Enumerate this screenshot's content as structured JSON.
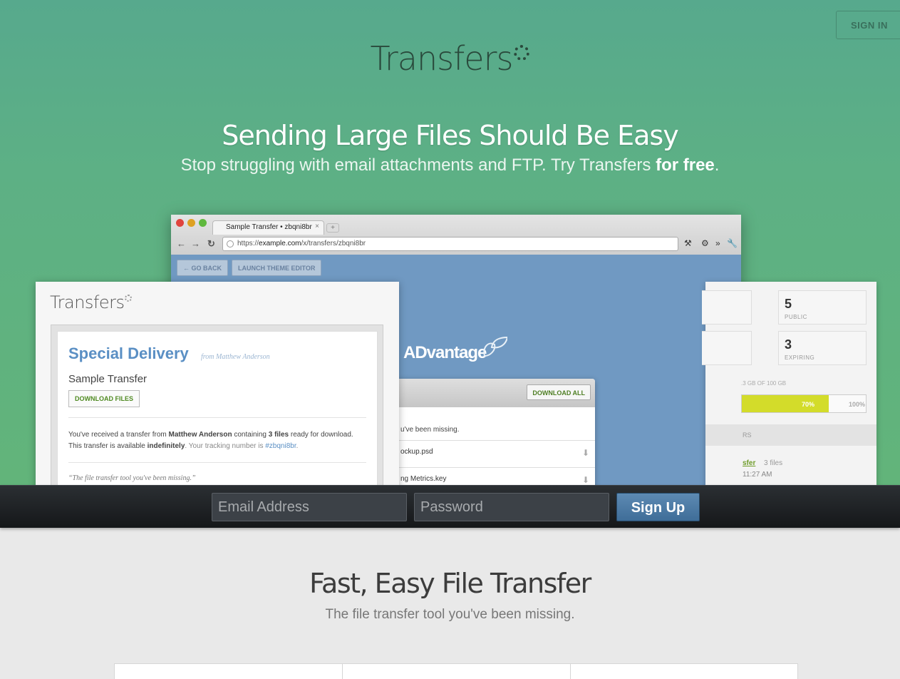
{
  "header": {
    "sign_in": "SIGN IN",
    "logo_text": "Transfers"
  },
  "hero": {
    "headline": "Sending Large Files Should Be Easy",
    "sub_pre": "Stop struggling with email attachments and FTP. Try Transfers ",
    "sub_bold": "for free",
    "sub_post": "."
  },
  "browser": {
    "tab_title": "Sample Transfer • zbqni8br",
    "tab_close": "×",
    "new_tab": "+",
    "url_scheme": "https://",
    "url_host": "example.com",
    "url_path": "/x/transfers/zbqni8br",
    "go_back": "← GO BACK",
    "theme_editor": "LAUNCH THEME EDITOR",
    "brand": "ADvantage",
    "download_all": "DOWNLOAD ALL",
    "tagline_fragment": "u've been missing.",
    "files": [
      "ockup.psd",
      "ng Metrics.key"
    ]
  },
  "stats": {
    "items": [
      {
        "n": "5",
        "l": "PUBLIC"
      },
      {
        "n": "3",
        "l": "EXPIRING"
      }
    ],
    "usage": ".3 GB OF 100 GB",
    "usage_percent": 70,
    "usage_label": "70%",
    "max_label": "100%",
    "band": "RS",
    "link": "sfer",
    "files": "3 files",
    "time": "11:27 AM"
  },
  "preview": {
    "logo": "Transfers",
    "title": "Special Delivery",
    "from": "from Matthew Anderson",
    "transfer_name": "Sample Transfer",
    "download_files": "DOWNLOAD FILES",
    "msg_a": "You've received a transfer from ",
    "msg_sender": "Matthew Anderson",
    "msg_b": " containing ",
    "msg_count": "3 files",
    "msg_c": " ready for download.",
    "msg_d": "This transfer is available ",
    "msg_avail": "indefinitely",
    "msg_e": ". Your tracking number is ",
    "msg_track": "#zbqni8br",
    "msg_f": ".",
    "quote": "“The file transfer tool you've been missing.”"
  },
  "signup": {
    "email_placeholder": "Email Address",
    "password_placeholder": "Password",
    "submit": "Sign Up"
  },
  "features": {
    "title": "Fast, Easy File Transfer",
    "subtitle": "The file transfer tool you've been missing."
  },
  "colors": {
    "accent": "#5a8fc4",
    "green": "#62b47a",
    "bar_fill": "#d3dc2a"
  }
}
